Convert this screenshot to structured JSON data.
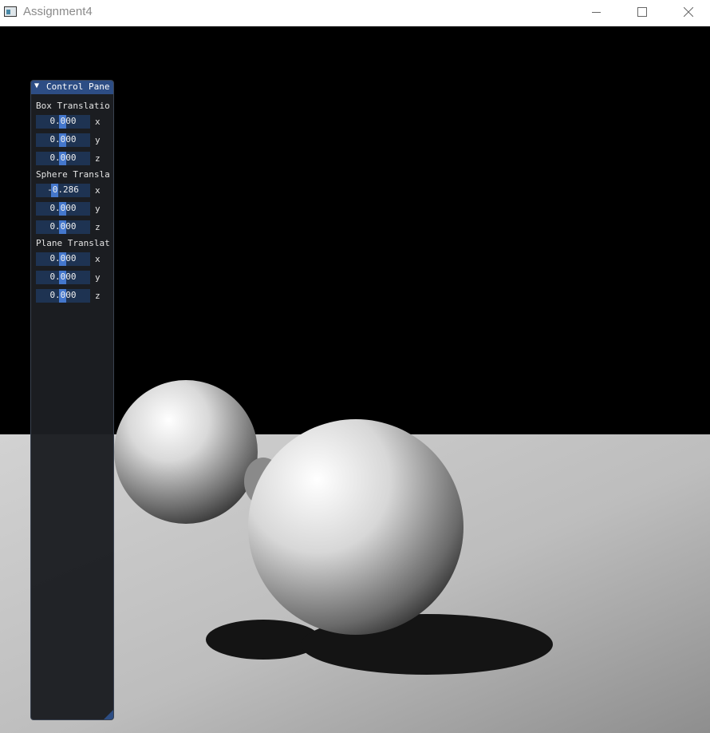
{
  "window": {
    "title": "Assignment4",
    "controls": {
      "minimize": "minimize-icon",
      "maximize": "maximize-icon",
      "close": "close-icon"
    }
  },
  "panel": {
    "title": "Control Pane",
    "collapse_icon": "▼",
    "sections": [
      {
        "label": "Box Translatio",
        "fields": [
          {
            "value": "0.000",
            "axis": "x",
            "fraction": 0.5
          },
          {
            "value": "0.000",
            "axis": "y",
            "fraction": 0.5
          },
          {
            "value": "0.000",
            "axis": "z",
            "fraction": 0.5
          }
        ]
      },
      {
        "label": "Sphere Transla",
        "fields": [
          {
            "value": "-0.286",
            "axis": "x",
            "fraction": 0.357
          },
          {
            "value": "0.000",
            "axis": "y",
            "fraction": 0.5
          },
          {
            "value": "0.000",
            "axis": "z",
            "fraction": 0.5
          }
        ]
      },
      {
        "label": "Plane Translat",
        "fields": [
          {
            "value": "0.000",
            "axis": "x",
            "fraction": 0.5
          },
          {
            "value": "0.000",
            "axis": "y",
            "fraction": 0.5
          },
          {
            "value": "0.000",
            "axis": "z",
            "fraction": 0.5
          }
        ]
      }
    ]
  },
  "colors": {
    "panel_header": "#2d4d84",
    "field_bg": "#1e3352",
    "slider_grab": "#4477cc",
    "background": "#000000"
  }
}
